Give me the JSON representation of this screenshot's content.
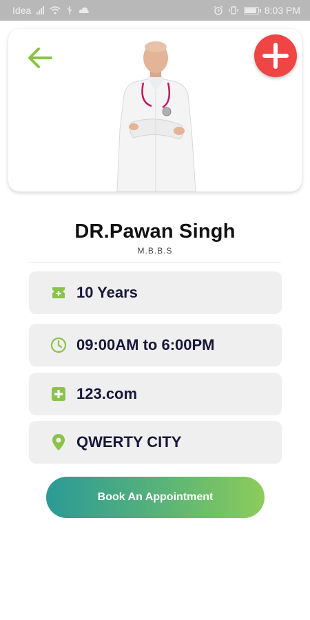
{
  "status_bar": {
    "carrier": "Idea",
    "time": "8:03 PM"
  },
  "header": {
    "back_icon": "arrow-left-icon",
    "add_icon": "plus-icon",
    "accent_color": "#8bc34a",
    "add_button_color": "#ef4545"
  },
  "doctor": {
    "name": "DR.Pawan Singh",
    "degree": "M.B.B.S"
  },
  "info": [
    {
      "icon": "experience-icon",
      "text": "10 Years"
    },
    {
      "icon": "clock-icon",
      "text": "09:00AM to 6:00PM"
    },
    {
      "icon": "medical-cross-icon",
      "text": "123.com"
    },
    {
      "icon": "location-pin-icon",
      "text": "QWERTY CITY"
    }
  ],
  "actions": {
    "book_label": "Book An Appointment",
    "gradient_start": "#2b9a96",
    "gradient_end": "#8ccc5a"
  }
}
